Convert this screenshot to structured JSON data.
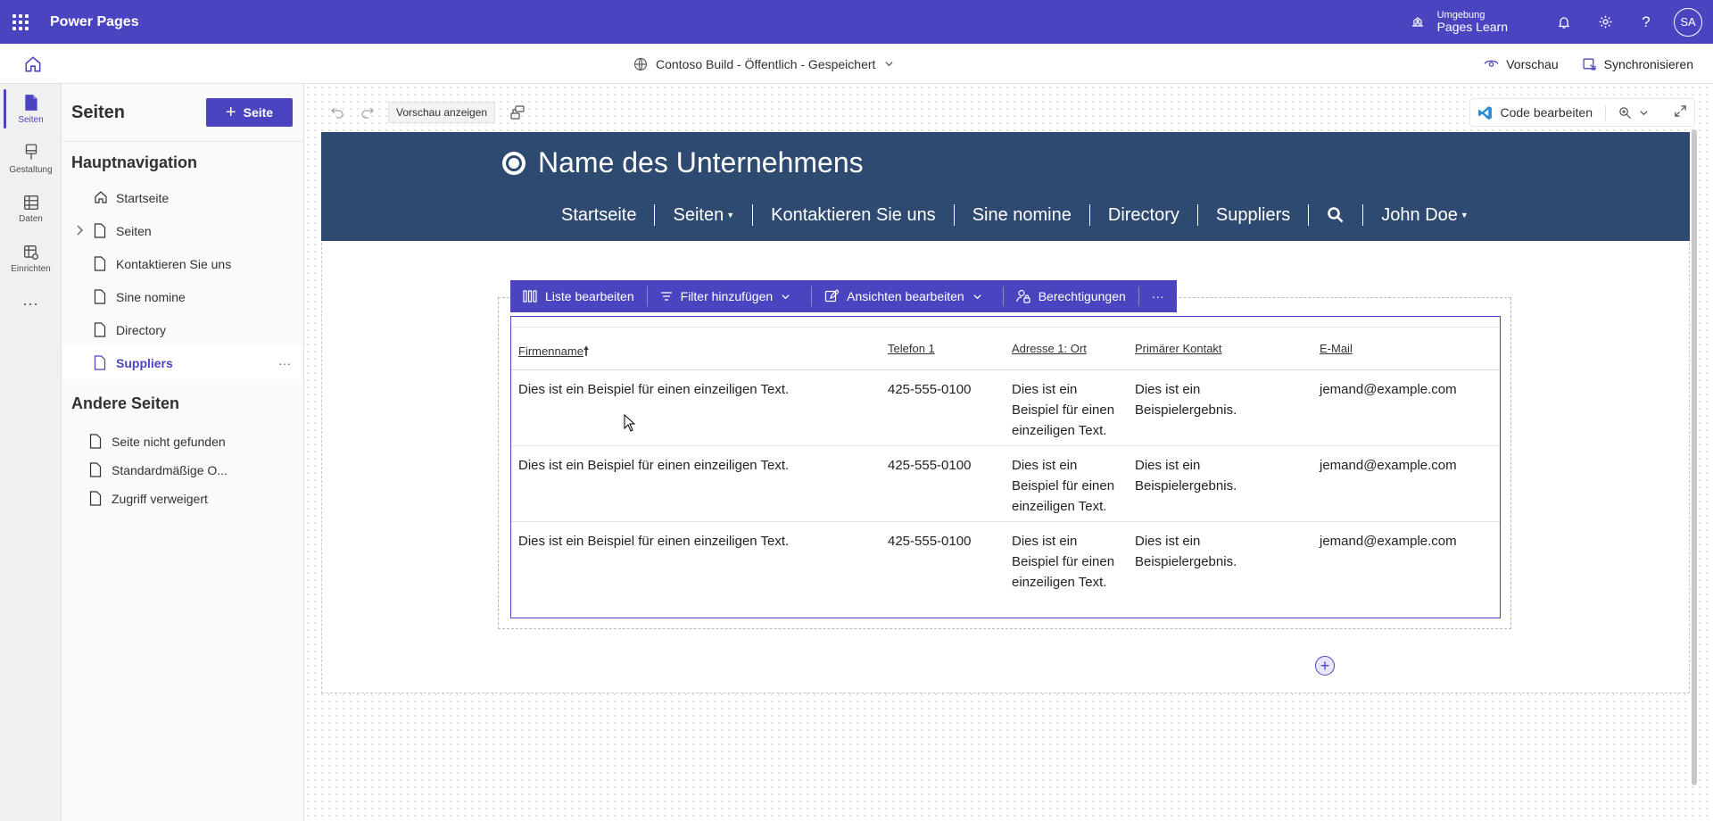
{
  "topbar": {
    "app_title": "Power Pages",
    "environment_label": "Umgebung",
    "environment_name": "Pages Learn",
    "avatar_initials": "SA",
    "accent": "#4b44c0"
  },
  "cmdbar": {
    "site_status": "Contoso Build - Öffentlich - Gespeichert",
    "preview_label": "Vorschau",
    "sync_label": "Synchronisieren"
  },
  "rail": {
    "items": [
      {
        "label": "Seiten",
        "icon": "page-icon"
      },
      {
        "label": "Gestaltung",
        "icon": "brush-icon"
      },
      {
        "label": "Daten",
        "icon": "table-icon"
      },
      {
        "label": "Einrichten",
        "icon": "settings-table-icon"
      }
    ],
    "more": "..."
  },
  "panel": {
    "title": "Seiten",
    "add_button": "Seite",
    "main_nav_title": "Hauptnavigation",
    "main_nav": [
      {
        "label": "Startseite",
        "icon": "home-icon"
      },
      {
        "label": "Seiten",
        "icon": "page-icon"
      },
      {
        "label": "Kontaktieren Sie uns",
        "icon": "page-icon"
      },
      {
        "label": "Sine nomine",
        "icon": "page-icon"
      },
      {
        "label": "Directory",
        "icon": "page-icon"
      },
      {
        "label": "Suppliers",
        "icon": "page-icon"
      }
    ],
    "other_title": "Andere Seiten",
    "other_pages": [
      {
        "label": "Seite nicht gefunden"
      },
      {
        "label": "Standardmäßige O..."
      },
      {
        "label": "Zugriff verweigert"
      }
    ],
    "more_dots": "···"
  },
  "canvas": {
    "preview_button": "Vorschau anzeigen",
    "code_button": "Code bearbeiten"
  },
  "site": {
    "brand": "Name des Unternehmens",
    "nav": [
      {
        "label": "Startseite"
      },
      {
        "label": "Seiten"
      },
      {
        "label": "Kontaktieren Sie uns"
      },
      {
        "label": "Sine nomine"
      },
      {
        "label": "Directory"
      },
      {
        "label": "Suppliers"
      },
      {
        "label": "John Doe"
      }
    ],
    "header_color": "#2f4a70"
  },
  "list_toolbar": {
    "edit_list": "Liste bearbeiten",
    "add_filter": "Filter hinzufügen",
    "edit_views": "Ansichten bearbeiten",
    "permissions": "Berechtigungen",
    "more": "···"
  },
  "list": {
    "columns": [
      "Firmenname",
      "Telefon 1",
      "Adresse 1: Ort",
      "Primärer Kontakt",
      "E-Mail"
    ],
    "rows": [
      [
        "Dies ist ein Beispiel für einen einzeiligen Text.",
        "425-555-0100",
        "Dies ist ein Beispiel für einen einzeiligen Text.",
        "Dies ist ein Beispielergebnis.",
        "jemand@example.com"
      ],
      [
        "Dies ist ein Beispiel für einen einzeiligen Text.",
        "425-555-0100",
        "Dies ist ein Beispiel für einen einzeiligen Text.",
        "Dies ist ein Beispielergebnis.",
        "jemand@example.com"
      ],
      [
        "Dies ist ein Beispiel für einen einzeiligen Text.",
        "425-555-0100",
        "Dies ist ein Beispiel für einen einzeiligen Text.",
        "Dies ist ein Beispielergebnis.",
        "jemand@example.com"
      ]
    ],
    "add_symbol": "+"
  }
}
